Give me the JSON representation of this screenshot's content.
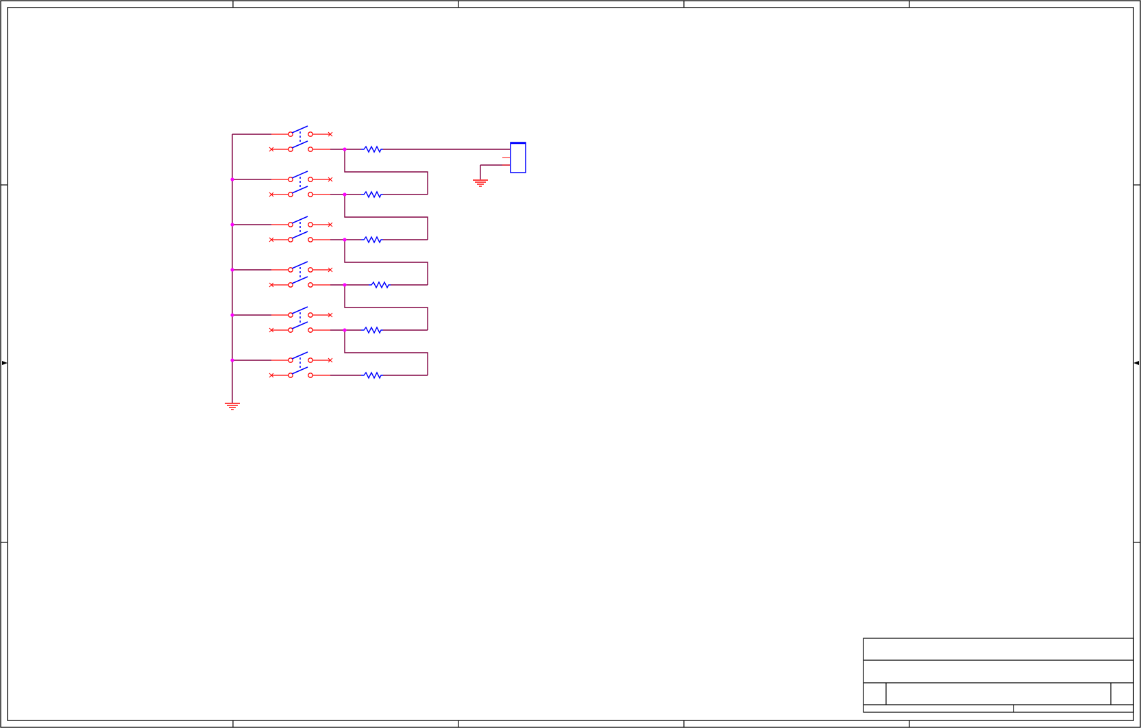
{
  "diagram": {
    "type": "schematic",
    "colors": {
      "paper": "#ffffff",
      "frame": "#000000",
      "wire": "#800040",
      "pin": "#ff0000",
      "part": "#0000ff",
      "junction": "#ff00ff"
    },
    "components": {
      "switch_count": 6,
      "resistor_count": 6,
      "connector_count": 1,
      "ground_count": 2,
      "junction_count": 10
    },
    "title_block": {
      "title": "",
      "document_number": "",
      "revision": "",
      "size": "",
      "date": "",
      "sheet": ""
    }
  }
}
